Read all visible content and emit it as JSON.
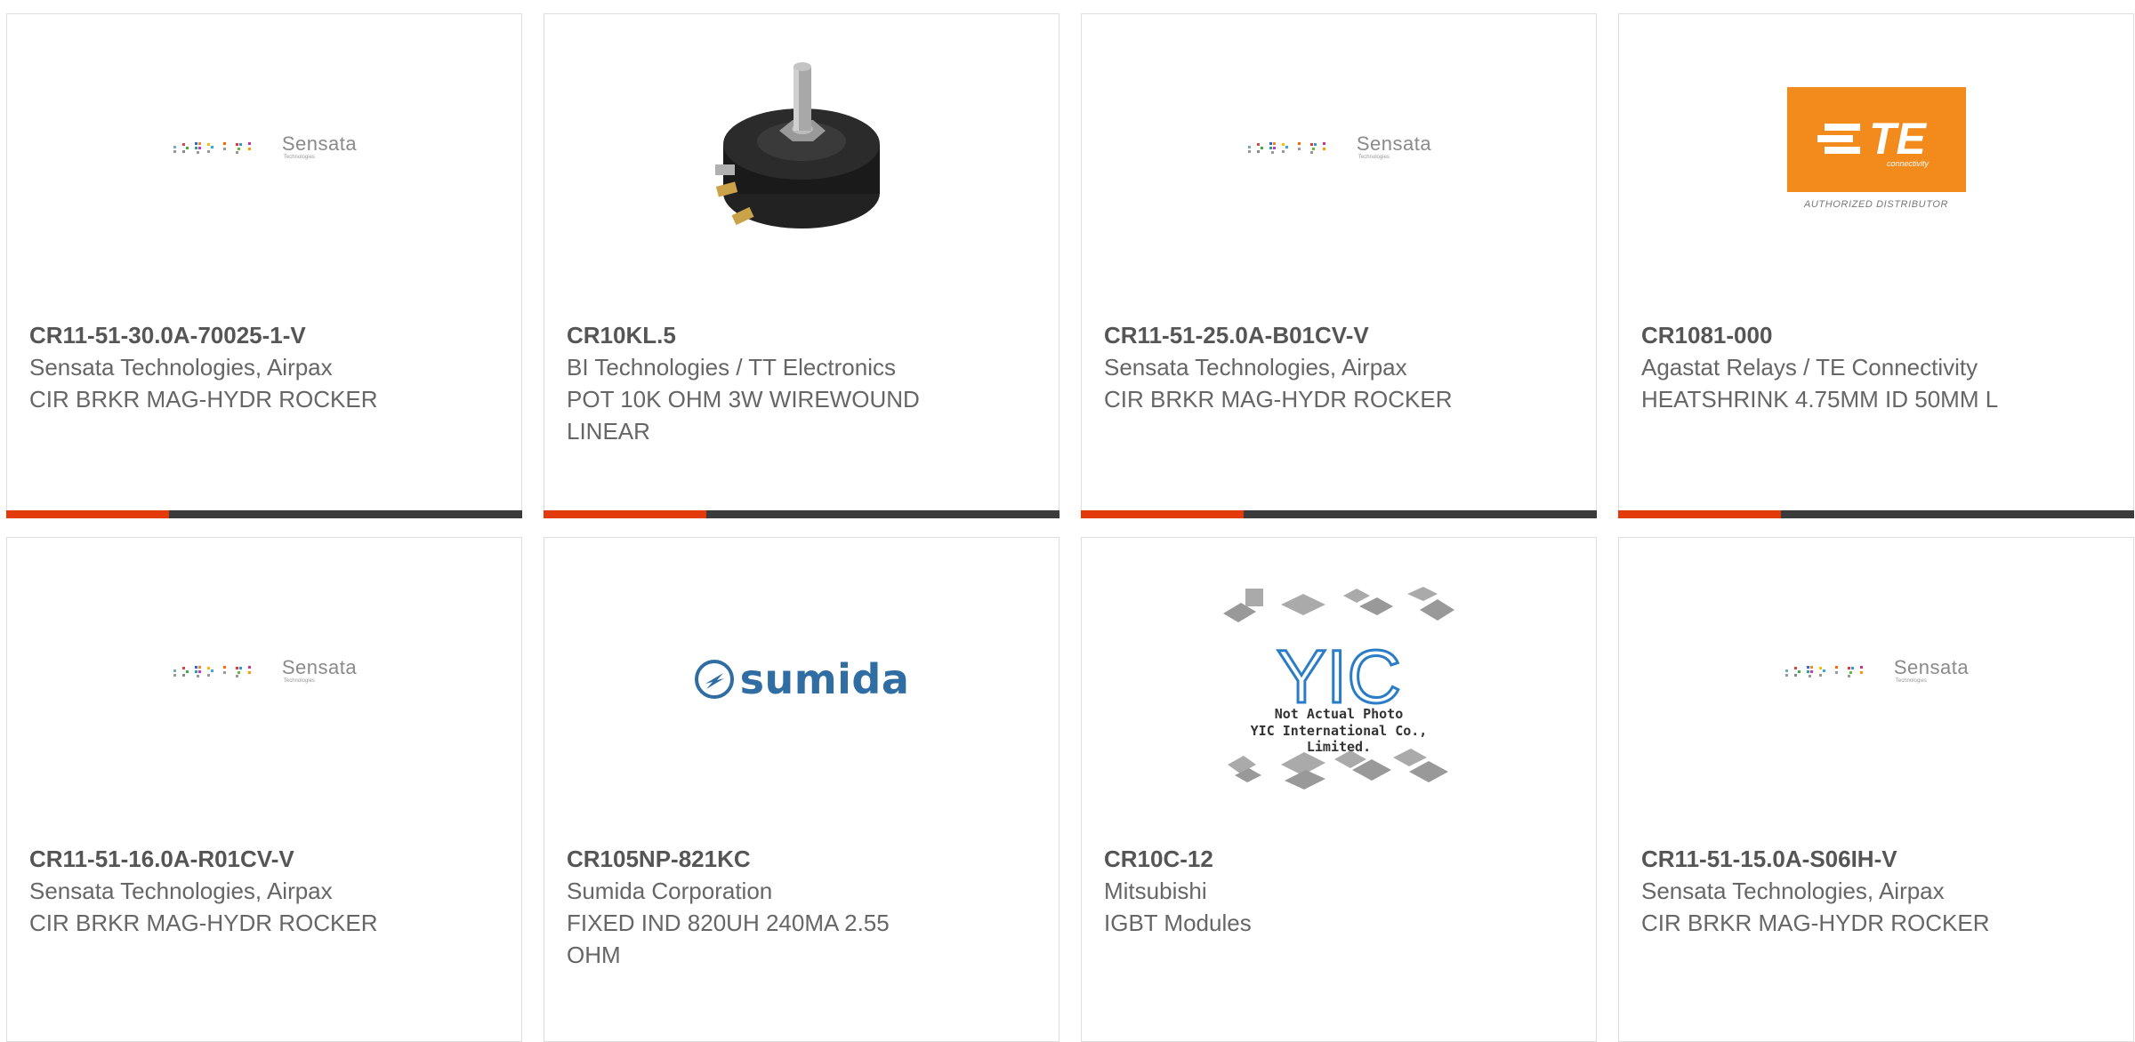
{
  "products": [
    {
      "part_number": "CR11-51-30.0A-70025-1-V",
      "manufacturer": "Sensata Technologies, Airpax",
      "description": "CIR BRKR MAG-HYDR ROCKER",
      "image": "sensata-logo"
    },
    {
      "part_number": "CR10KL.5",
      "manufacturer": "BI Technologies / TT Electronics",
      "description": "POT 10K OHM 3W WIREWOUND LINEAR",
      "image": "potentiometer-photo"
    },
    {
      "part_number": "CR11-51-25.0A-B01CV-V",
      "manufacturer": "Sensata Technologies, Airpax",
      "description": "CIR BRKR MAG-HYDR ROCKER",
      "image": "sensata-logo"
    },
    {
      "part_number": "CR1081-000",
      "manufacturer": "Agastat Relays / TE Connectivity",
      "description": "HEATSHRINK 4.75MM ID 50MM L",
      "image": "te-logo"
    },
    {
      "part_number": "CR11-51-16.0A-R01CV-V",
      "manufacturer": "Sensata Technologies, Airpax",
      "description": "CIR BRKR MAG-HYDR ROCKER",
      "image": "sensata-logo"
    },
    {
      "part_number": "CR105NP-821KC",
      "manufacturer": "Sumida Corporation",
      "description": "FIXED IND 820UH 240MA 2.55 OHM",
      "image": "sumida-logo"
    },
    {
      "part_number": "CR10C-12",
      "manufacturer": "Mitsubishi",
      "description": "IGBT Modules",
      "image": "yic-placeholder"
    },
    {
      "part_number": "CR11-51-15.0A-S06IH-V",
      "manufacturer": "Sensata Technologies, Airpax",
      "description": "CIR BRKR MAG-HYDR ROCKER",
      "image": "sensata-logo"
    }
  ],
  "logos": {
    "sensata": {
      "name": "Sensata",
      "sub": "Technologies"
    },
    "te": {
      "mark": "TE",
      "sub": "connectivity",
      "authorized": "AUTHORIZED DISTRIBUTOR"
    },
    "sumida": {
      "name": "sumida"
    },
    "yic": {
      "mark": "YIC",
      "caption1": "Not Actual Photo",
      "caption2": "YIC International Co., Limited."
    }
  },
  "colors": {
    "accent": "#e33a0c",
    "bar": "#3b3b3b",
    "te_orange": "#f28a1c",
    "sumida_blue": "#2f6da3"
  }
}
